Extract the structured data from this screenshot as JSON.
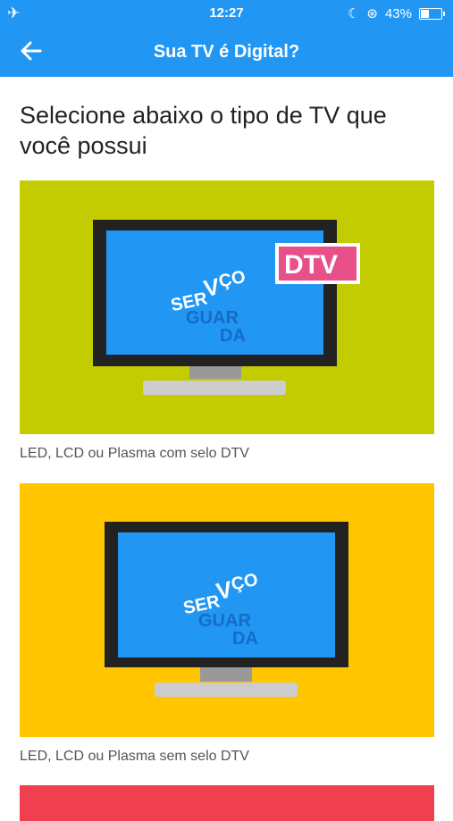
{
  "status_bar": {
    "time": "12:27",
    "battery": "43%",
    "battery_level": 0.43
  },
  "app_bar": {
    "title": "Sua TV é Digital?",
    "back_icon": "arrow-left-icon"
  },
  "heading": "Selecione abaixo o tipo de TV que você possui",
  "options": [
    {
      "caption": "LED, LCD ou Plasma com selo DTV",
      "background": "#c2cc00",
      "logo": "SERVIÇO ANTENAGUARDA",
      "badge": "DTV"
    },
    {
      "caption": "LED, LCD ou Plasma sem selo DTV",
      "background": "#ffc600",
      "logo": "SERVIÇO ANTENAGUARDA"
    }
  ],
  "colors": {
    "primary": "#2196f3",
    "screen": "#2196f3",
    "badge": "#e8508a",
    "third_card": "#f04050"
  }
}
